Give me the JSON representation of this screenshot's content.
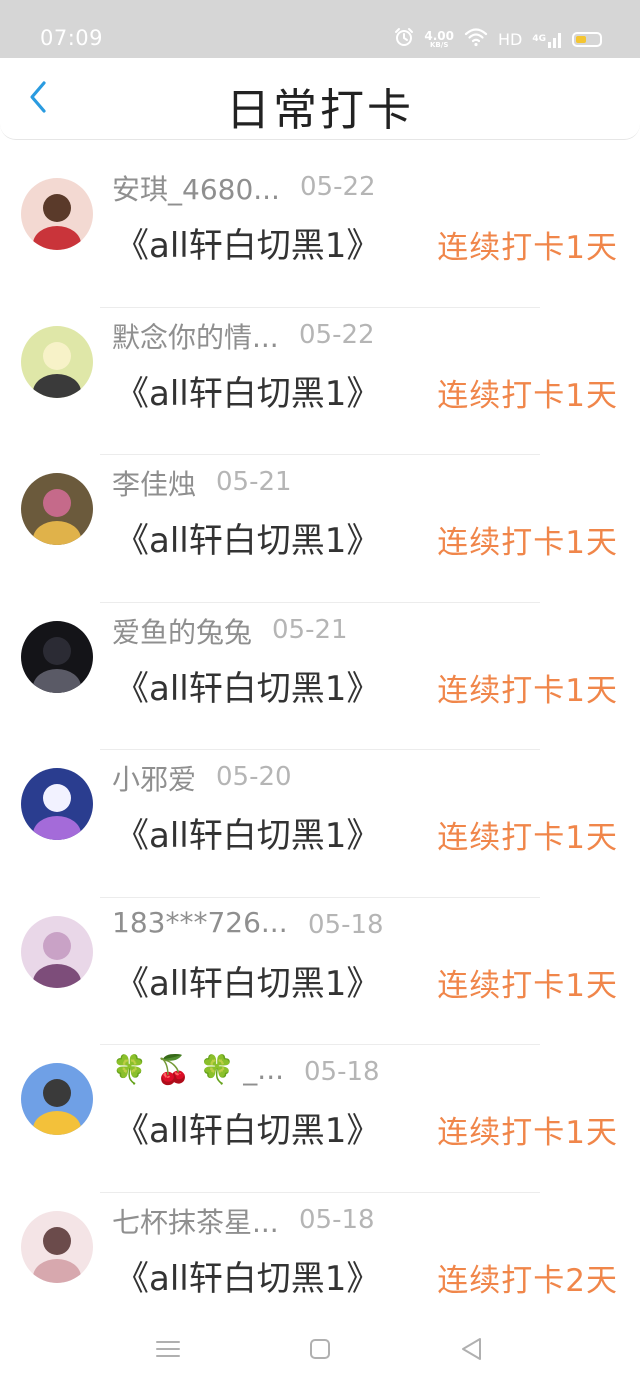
{
  "status_bar": {
    "time": "07:09",
    "net_speed": "4.00",
    "net_speed_unit": "KB/S",
    "hd": "HD",
    "signal": "4G",
    "colors": {
      "background": "#d6d6d6",
      "battery_fill": "#f4c531"
    }
  },
  "header": {
    "title": "日常打卡",
    "back_icon": "chevron-left-icon",
    "colors": {
      "back_icon": "#2a9be0"
    }
  },
  "list": {
    "items": [
      {
        "username": "安琪_4680...",
        "date": "05-22",
        "book": "《all轩白切黑1》",
        "streak": "连续打卡1天"
      },
      {
        "username": "默念你的情...",
        "date": "05-22",
        "book": "《all轩白切黑1》",
        "streak": "连续打卡1天"
      },
      {
        "username": "李佳烛",
        "date": "05-21",
        "book": "《all轩白切黑1》",
        "streak": "连续打卡1天"
      },
      {
        "username": "爱鱼的兔兔",
        "date": "05-21",
        "book": "《all轩白切黑1》",
        "streak": "连续打卡1天"
      },
      {
        "username": "小邪爱",
        "date": "05-20",
        "book": "《all轩白切黑1》",
        "streak": "连续打卡1天"
      },
      {
        "username": "183***726...",
        "date": "05-18",
        "book": "《all轩白切黑1》",
        "streak": "连续打卡1天"
      },
      {
        "username": "🍀 🍒 🍀 _...",
        "date": "05-18",
        "book": "《all轩白切黑1》",
        "streak": "连续打卡1天"
      },
      {
        "username": "七杯抹茶星...",
        "date": "05-18",
        "book": "《all轩白切黑1》",
        "streak": "连续打卡2天"
      }
    ],
    "colors": {
      "username": "#8f8f8f",
      "date": "#b5b5b5",
      "book": "#333333",
      "streak": "#f0864a"
    }
  },
  "nav_bar": {
    "icons": [
      "menu-icon",
      "home-square-icon",
      "back-triangle-icon"
    ]
  }
}
